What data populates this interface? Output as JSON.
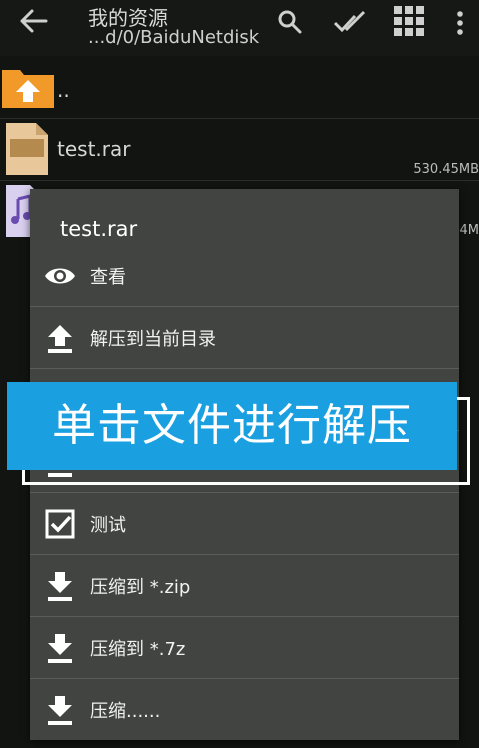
{
  "header": {
    "title": "我的资源",
    "path": "...d/0/BaiduNetdisk"
  },
  "files": [
    {
      "name": "..",
      "icon": "folder-up-icon"
    },
    {
      "name": "test.rar",
      "size": "530.45MB",
      "icon": "archive-icon"
    },
    {
      "name": "",
      "size": "4M",
      "icon": "music-file-icon"
    }
  ],
  "dialog": {
    "title": "test.rar",
    "items": [
      {
        "label": "查看",
        "icon": "eye-icon"
      },
      {
        "label": "解压到当前目录",
        "icon": "upload-arrow-icon"
      },
      {
        "label": "",
        "icon": "extract-icon"
      },
      {
        "label": "",
        "icon": "extract-icon"
      },
      {
        "label": "测试",
        "icon": "checkbox-icon"
      },
      {
        "label": "压缩到 *.zip",
        "icon": "download-arrow-icon"
      },
      {
        "label": "压缩到 *.7z",
        "icon": "download-arrow-icon"
      },
      {
        "label": "压缩......",
        "icon": "download-arrow-icon"
      }
    ]
  },
  "overlay": {
    "caption": "单击文件进行解压"
  },
  "colors": {
    "background": "#111411",
    "dialog": "#414440",
    "caption_bg": "#1aa0e0",
    "folder": "#f19a2a"
  }
}
